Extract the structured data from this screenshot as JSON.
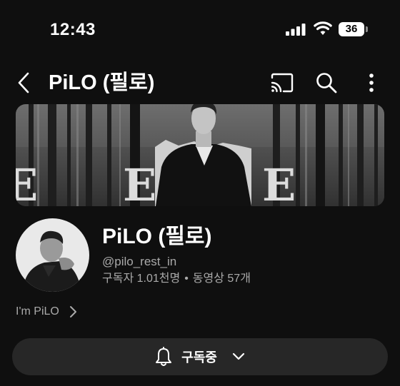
{
  "status_bar": {
    "time": "12:43",
    "battery": "36"
  },
  "header": {
    "title": "PiLO (필로)",
    "icons": {
      "back": "back-arrow-icon",
      "cast": "cast-icon",
      "search": "search-icon",
      "more": "more-vertical-icon"
    }
  },
  "banner": {
    "left_text": "E",
    "right_text": "E"
  },
  "channel": {
    "name": "PiLO (필로)",
    "handle": "@pilo_rest_in",
    "subscribers": "구독자 1.01천명",
    "separator": "•",
    "videos": "동영상 57개"
  },
  "about": {
    "text": "I'm PiLO"
  },
  "subscribe": {
    "label": "구독중"
  },
  "colors": {
    "background": "#0f0f0f",
    "button_bg": "#272727",
    "secondary_text": "#aaaaaa"
  }
}
